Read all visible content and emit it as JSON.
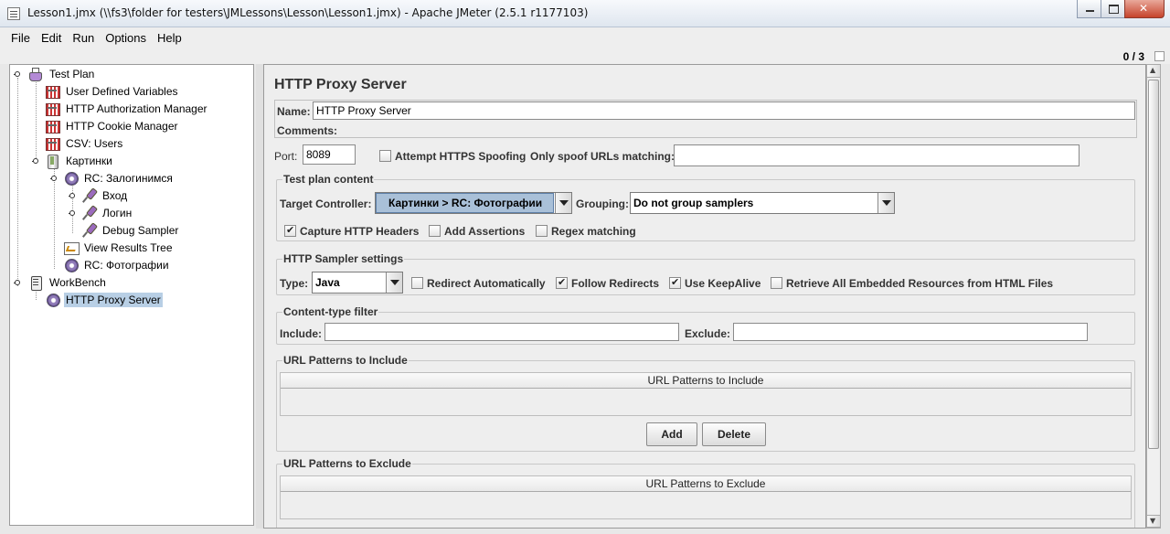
{
  "window": {
    "title": "Lesson1.jmx (\\\\fs3\\folder for testers\\JMLessons\\Lesson\\Lesson1.jmx) - Apache JMeter (2.5.1 r1177103)"
  },
  "menu": [
    "File",
    "Edit",
    "Run",
    "Options",
    "Help"
  ],
  "counter": "0 / 3",
  "tree": {
    "items": [
      {
        "label": "Test Plan",
        "icon": "flask-icon"
      },
      {
        "label": "User Defined Variables",
        "icon": "config-icon"
      },
      {
        "label": "HTTP Authorization Manager",
        "icon": "config-icon"
      },
      {
        "label": "HTTP Cookie Manager",
        "icon": "config-icon"
      },
      {
        "label": "CSV: Users",
        "icon": "config-icon"
      },
      {
        "label": "Картинки",
        "icon": "thread-group-icon"
      },
      {
        "label": "RC: Залогинимся",
        "icon": "controller-gear-icon"
      },
      {
        "label": "Вход",
        "icon": "sampler-pipette-icon"
      },
      {
        "label": "Логин",
        "icon": "sampler-pipette-icon"
      },
      {
        "label": "Debug Sampler",
        "icon": "sampler-pipette-icon"
      },
      {
        "label": "View Results Tree",
        "icon": "listener-graph-icon"
      },
      {
        "label": "RC: Фотографии",
        "icon": "controller-gear-icon"
      },
      {
        "label": "WorkBench",
        "icon": "workbench-icon"
      },
      {
        "label": "HTTP Proxy Server",
        "icon": "controller-gear-icon",
        "selected": true
      }
    ]
  },
  "panel": {
    "title": "HTTP Proxy Server",
    "name_label": "Name:",
    "name_value": "HTTP Proxy Server",
    "comments_label": "Comments:",
    "port_label": "Port:",
    "port_value": "8089",
    "https_spoofing_label": "Attempt HTTPS Spoofing",
    "https_spoofing_checked": false,
    "spoof_label": "Only spoof URLs matching:",
    "spoof_value": "",
    "test_plan_content": {
      "title": "Test plan content",
      "target_label": "Target Controller:",
      "target_value": "Картинки > RC: Фотографии",
      "grouping_label": "Grouping:",
      "grouping_value": "Do not group samplers",
      "capture_headers": {
        "label": "Capture HTTP Headers",
        "checked": true
      },
      "add_assertions": {
        "label": "Add Assertions",
        "checked": false
      },
      "regex_matching": {
        "label": "Regex matching",
        "checked": false
      }
    },
    "sampler_settings": {
      "title": "HTTP Sampler settings",
      "type_label": "Type:",
      "type_value": "Java",
      "redirect_auto": {
        "label": "Redirect Automatically",
        "checked": false
      },
      "follow_redirects": {
        "label": "Follow Redirects",
        "checked": true
      },
      "keepalive": {
        "label": "Use KeepAlive",
        "checked": true
      },
      "embedded": {
        "label": "Retrieve All Embedded Resources from HTML Files",
        "checked": false
      }
    },
    "content_filter": {
      "title": "Content-type filter",
      "include_label": "Include:",
      "include_value": "",
      "exclude_label": "Exclude:",
      "exclude_value": ""
    },
    "include_patterns": {
      "title": "URL Patterns to Include",
      "column": "URL Patterns to Include",
      "add_label": "Add",
      "delete_label": "Delete"
    },
    "exclude_patterns": {
      "title": "URL Patterns to Exclude",
      "column": "URL Patterns to Exclude"
    }
  }
}
